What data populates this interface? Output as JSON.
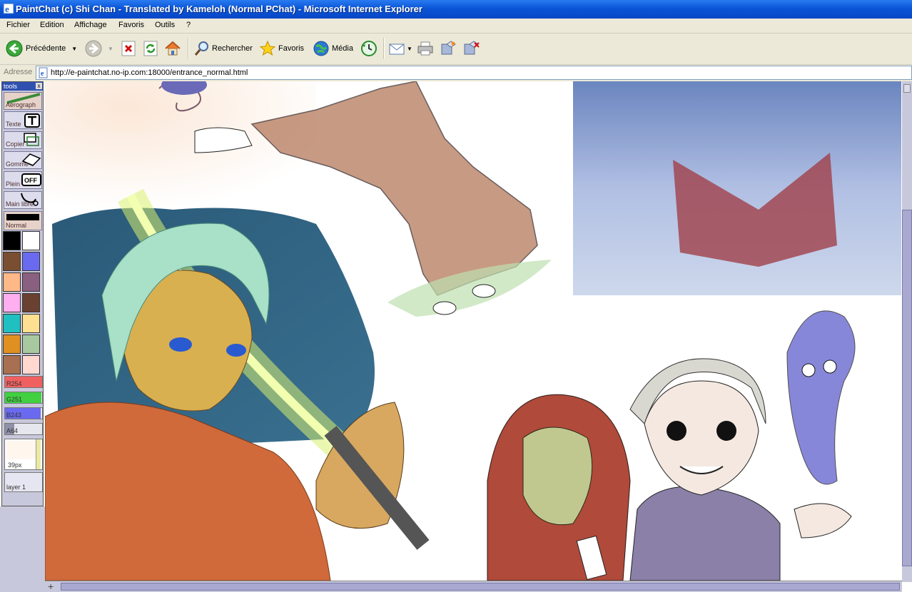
{
  "window": {
    "title": "PaintChat (c) Shi Chan - Translated by Kameloh (Normal PChat) - Microsoft Internet Explorer"
  },
  "menu": [
    "Fichier",
    "Edition",
    "Affichage",
    "Favoris",
    "Outils",
    "?"
  ],
  "toolbar": {
    "back_label": "Précédente",
    "search_label": "Rechercher",
    "favorites_label": "Favoris",
    "media_label": "Média"
  },
  "address": {
    "label": "Adresse",
    "url": "http://e-paintchat.no-ip.com:18000/entrance_normal.html"
  },
  "tools": {
    "header": "tools",
    "close": "x",
    "items": [
      "Aerograph",
      "Texte",
      "Copier",
      "Gomme",
      "Plein",
      "Main libre"
    ],
    "pen_mode": "Normal",
    "sliders": [
      {
        "label": "R254",
        "value": 254,
        "max": 255,
        "color": "#f06060"
      },
      {
        "label": "G251",
        "value": 251,
        "max": 255,
        "color": "#40d040"
      },
      {
        "label": "B243",
        "value": 243,
        "max": 255,
        "color": "#6a6af0"
      },
      {
        "label": "A64",
        "value": 64,
        "max": 255,
        "color": "#9090a8"
      }
    ],
    "size_label": "39px",
    "layer_label": "layer 1"
  },
  "palette": [
    "#000000",
    "#ffffff",
    "#7a4e30",
    "#6a6af0",
    "#ffb888",
    "#8a6080",
    "#ffaef0",
    "#6a4030",
    "#20c0c0",
    "#ffe090",
    "#e09020",
    "#a8c8a0",
    "#a87050",
    "#ffd8d0"
  ],
  "scrollbar": {
    "corner_icon": "+"
  }
}
